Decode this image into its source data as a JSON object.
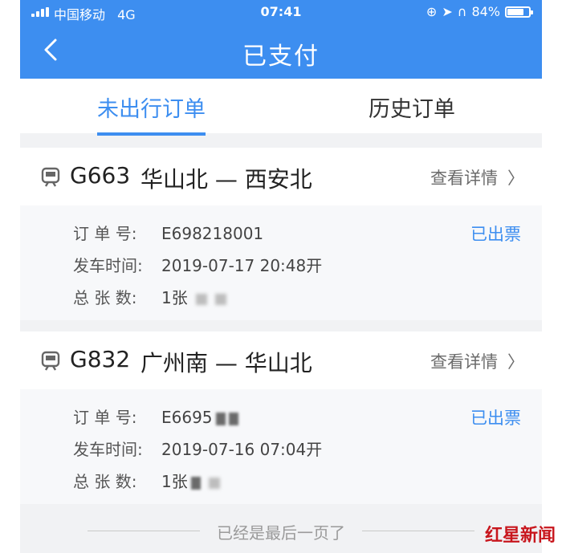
{
  "status_bar": {
    "carrier": "中国移动",
    "network": "4G",
    "time": "07:41",
    "battery": "84%",
    "battery_level": 0.84
  },
  "nav": {
    "title": "已支付"
  },
  "tabs": [
    {
      "label": "未出行订单",
      "active": true
    },
    {
      "label": "历史订单",
      "active": false
    }
  ],
  "orders": [
    {
      "train": "G663",
      "route": "华山北 — 西安北",
      "detail_link": "查看详情",
      "status": "已出票",
      "order_label": "订 单 号:",
      "order_no": "E698218001",
      "depart_label": "发车时间:",
      "depart_time": "2019-07-17  20:48开",
      "count_label": "总 张 数:",
      "count": "1张"
    },
    {
      "train": "G832",
      "route": "广州南 — 华山北",
      "detail_link": "查看详情",
      "status": "已出票",
      "order_label": "订 单 号:",
      "order_no": "E6695",
      "depart_label": "发车时间:",
      "depart_time": "2019-07-16  07:04开",
      "count_label": "总 张 数:",
      "count": "1张"
    }
  ],
  "footer": {
    "end_text": "已经是最后一页了"
  },
  "watermark": {
    "text": "红星新闻"
  },
  "colors": {
    "accent": "#3d8ef0",
    "watermark": "#c8161d"
  },
  "icons": [
    "signal-icon",
    "back-arrow-icon",
    "train-icon",
    "chevron-right-icon",
    "location-icon",
    "headphones-icon",
    "battery-icon"
  ]
}
